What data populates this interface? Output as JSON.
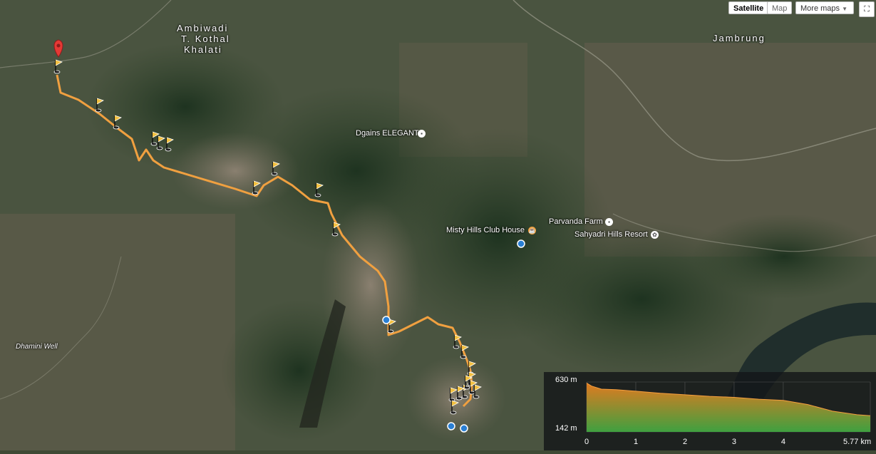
{
  "map_type_control": {
    "satellite_label": "Satellite",
    "map_label": "Map",
    "more_label": "More maps",
    "selected": "Satellite"
  },
  "place_labels": {
    "ambiwadi": "Ambiwadi",
    "kothal": "T. Kothal",
    "khalati": "Khalati",
    "jambrung": "Jambrung",
    "dgains": "Dgains ELEGANT",
    "misty_hills": "Misty Hills Club House",
    "parvanda": "Parvanda Farm",
    "sahyadri": "Sahyadri Hills Resort",
    "dhamini": "Dhamini Well"
  },
  "route": {
    "color": "#f0a040",
    "marker": "start-pin",
    "waypoint_count": 22
  },
  "elevation_profile": {
    "y_max_label": "630 m",
    "y_min_label": "142 m",
    "x_ticks": [
      "0",
      "1",
      "2",
      "3",
      "4",
      "5.77 km"
    ],
    "fill_top_color": "#e07a20",
    "fill_bottom_color": "#3fa040"
  },
  "chart_data": {
    "type": "area",
    "x": [
      0,
      0.1,
      0.3,
      0.6,
      1.0,
      1.5,
      2.0,
      2.5,
      3.0,
      3.5,
      4.0,
      4.5,
      5.0,
      5.5,
      5.77
    ],
    "y": [
      620,
      590,
      560,
      555,
      540,
      520,
      505,
      490,
      480,
      462,
      450,
      410,
      345,
      310,
      300
    ],
    "ylim": [
      142,
      630
    ],
    "xlim": [
      0,
      5.77
    ],
    "xlabel": "",
    "ylabel": ""
  }
}
